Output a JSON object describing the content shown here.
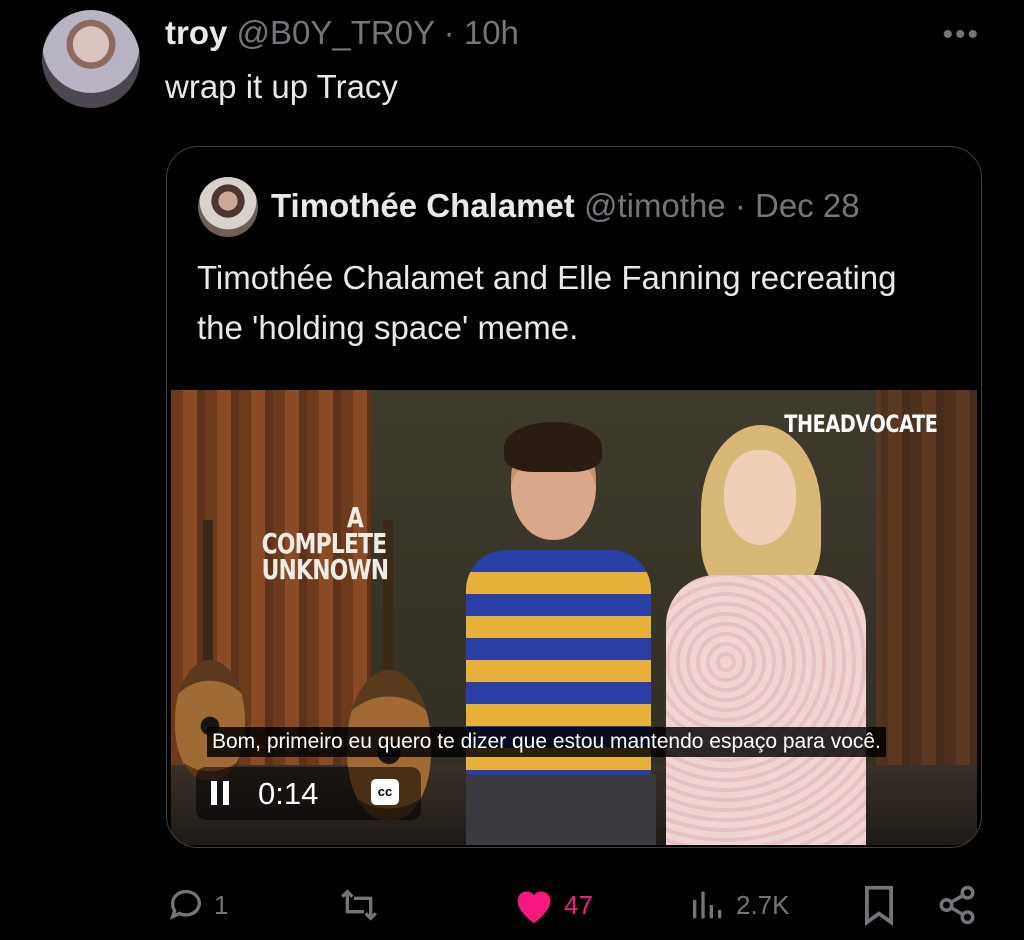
{
  "post": {
    "display_name": "troy",
    "handle": "@B0Y_TR0Y",
    "separator": "·",
    "time": "10h",
    "text": "wrap it up Tracy"
  },
  "quoted": {
    "display_name": "Timothée Chalamet",
    "handle": "@timothe",
    "separator": "·",
    "date": "Dec 28",
    "text": "Timothée Chalamet and Elle Fanning recreating the 'holding space' meme."
  },
  "video": {
    "title_lines": [
      "A",
      "COMPLETE",
      "UNKNOWN"
    ],
    "brand": "THEADVOCATE",
    "caption": "Bom, primeiro eu quero te dizer que estou mantendo espaço para você.",
    "time": "0:14",
    "cc_label": "cc"
  },
  "actions": {
    "replies": "1",
    "reposts": "",
    "likes": "47",
    "views": "2.7K"
  },
  "colors": {
    "background": "#000000",
    "muted": "#71767b",
    "like": "#f91880",
    "border": "#3e4144"
  },
  "icons": [
    "more-icon",
    "reply-icon",
    "repost-icon",
    "heart-icon",
    "views-icon",
    "bookmark-icon",
    "share-icon",
    "pause-icon",
    "cc-icon"
  ]
}
